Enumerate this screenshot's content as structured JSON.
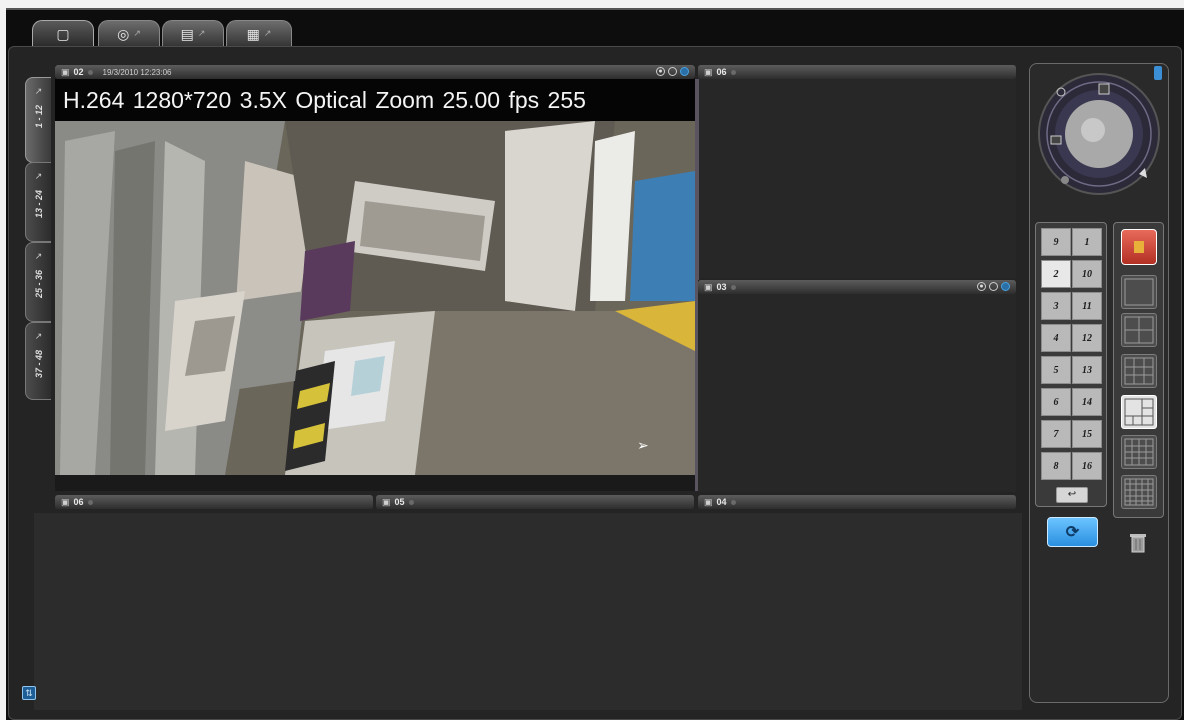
{
  "top_tabs": [
    {
      "name": "live-view",
      "glyph": "▢",
      "active": true
    },
    {
      "name": "playback",
      "glyph": "◎",
      "active": false
    },
    {
      "name": "config",
      "glyph": "▤",
      "active": false
    },
    {
      "name": "logs",
      "glyph": "▦",
      "active": false
    }
  ],
  "side_tabs": [
    {
      "label": "1 - 12",
      "active": true
    },
    {
      "label": "13 - 24",
      "active": false
    },
    {
      "label": "25 - 36",
      "active": false
    },
    {
      "label": "37 - 48",
      "active": false
    }
  ],
  "main_camera": {
    "number": "02",
    "timestamp": "19/3/2010 12:23:06",
    "osd_text": "H.264   1280*720   3.5X Optical Zoom   25.00 fps   255"
  },
  "cameras": {
    "cam06": "06",
    "cam03": "03",
    "cam06_bottom": "06",
    "cam05": "05",
    "cam04": "04"
  },
  "numpad": [
    "9",
    "1",
    "2",
    "10",
    "3",
    "11",
    "4",
    "12",
    "5",
    "13",
    "6",
    "14",
    "7",
    "15",
    "8",
    "16"
  ],
  "numpad_selected": "2",
  "accent_colors": {
    "record_button": "#d9473a",
    "refresh_button": "#3aa0ef",
    "osd_bg": "#050505"
  }
}
